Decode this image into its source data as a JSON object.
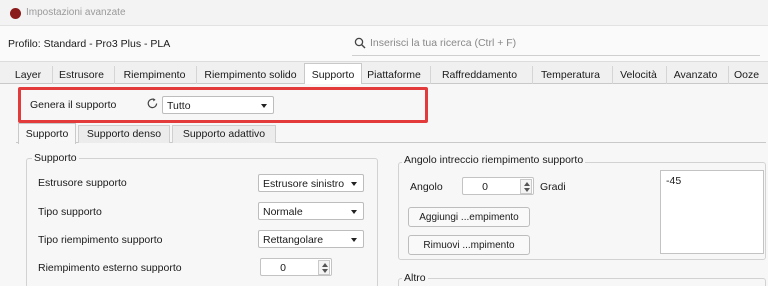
{
  "window": {
    "title": "Impostazioni avanzate"
  },
  "profile": {
    "label": "Profilo: Standard - Pro3 Plus - PLA"
  },
  "search": {
    "placeholder": "Inserisci la tua ricerca (Ctrl + F)",
    "value": ""
  },
  "tabs": [
    {
      "label": "Layer"
    },
    {
      "label": "Estrusore"
    },
    {
      "label": "Riempimento"
    },
    {
      "label": "Riempimento solido"
    },
    {
      "label": "Supporto",
      "active": true
    },
    {
      "label": "Piattaforme"
    },
    {
      "label": "Raffreddamento"
    },
    {
      "label": "Temperatura"
    },
    {
      "label": "Velocità"
    },
    {
      "label": "Avanzato"
    },
    {
      "label": "Ooze"
    }
  ],
  "generate_support": {
    "label": "Genera il supporto",
    "value": "Tutto",
    "reset_icon": "reset-icon"
  },
  "highlight_color": "#e33b3b",
  "subtabs": [
    {
      "label": "Supporto",
      "active": true
    },
    {
      "label": "Supporto denso"
    },
    {
      "label": "Supporto adattivo"
    }
  ],
  "support_group": {
    "title": "Supporto",
    "extruder": {
      "label": "Estrusore supporto",
      "value": "Estrusore sinistro"
    },
    "type": {
      "label": "Tipo supporto",
      "value": "Normale"
    },
    "infill_type": {
      "label": "Tipo riempimento supporto",
      "value": "Rettangolare"
    },
    "outer_infill": {
      "label": "Riempimento esterno supporto",
      "value": "0"
    }
  },
  "angle_group": {
    "title": "Angolo intreccio riempimento supporto",
    "angle_label": "Angolo",
    "angle_value": "0",
    "unit": "Gradi",
    "add_button": "Aggiungi ...empimento",
    "remove_button": "Rimuovi ...mpimento",
    "list_items": [
      "-45"
    ]
  },
  "other_group": {
    "title": "Altro"
  }
}
